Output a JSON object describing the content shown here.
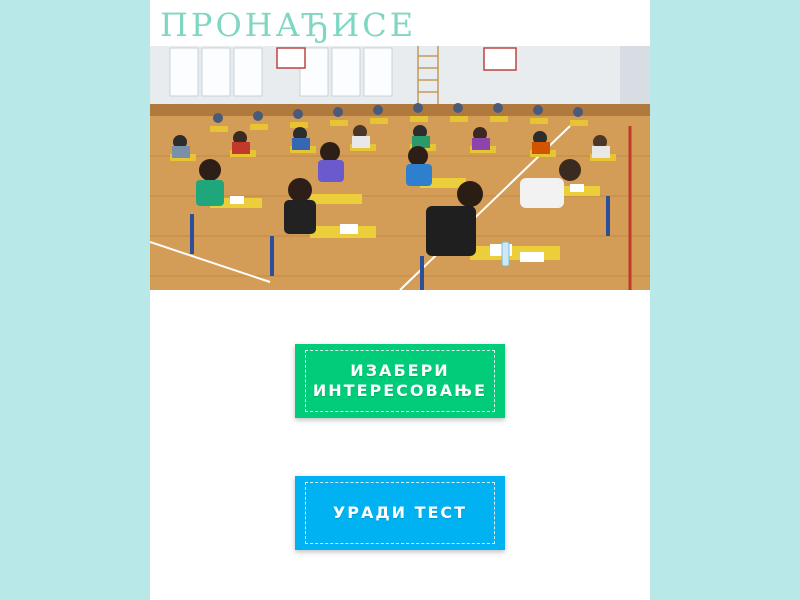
{
  "brand": {
    "logo_text": "ПРОНАЂИСЕ"
  },
  "hero": {
    "image": "students-writing-exam-in-gym-photo"
  },
  "buttons": {
    "choose_interest": "ИЗАБЕРИ\nИНТЕРЕСОВАЊЕ",
    "take_test": "УРАДИ ТЕСТ"
  },
  "colors": {
    "background": "#b9e8e8",
    "logo": "#7fd6c2",
    "button_green": "#00cc7a",
    "button_blue": "#00b2f2"
  }
}
